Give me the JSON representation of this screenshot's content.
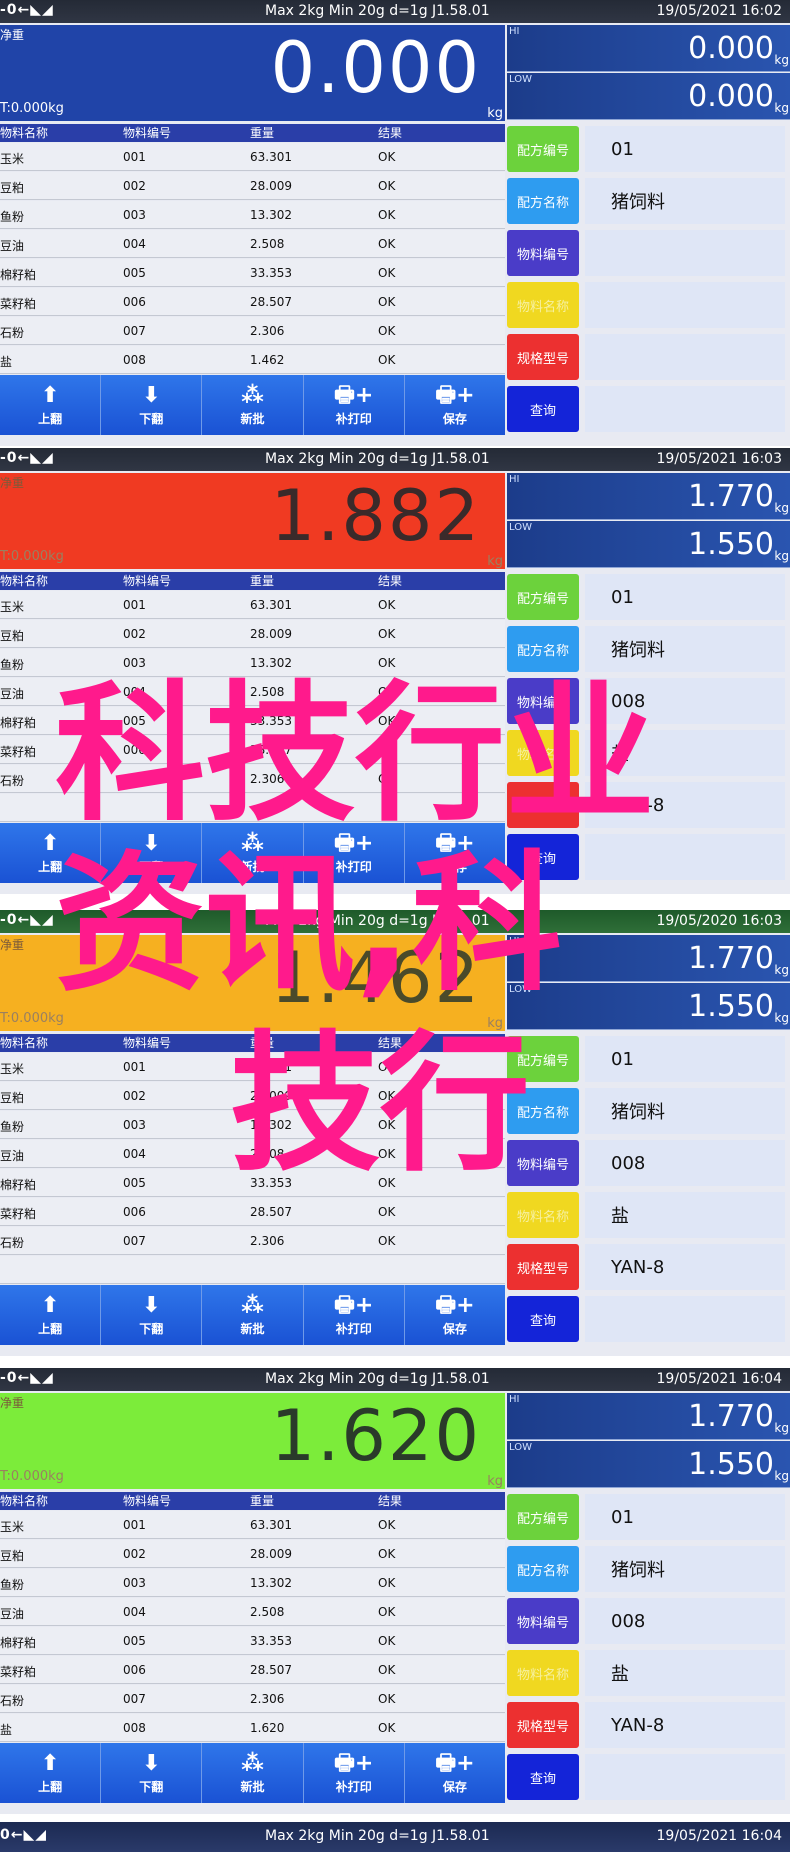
{
  "spec_text": "Max 2kg  Min 20g  d=1g    J1.58.01",
  "status_icons": "-0←◣◢",
  "net_label": "净重",
  "tare_text": "T:0.000kg",
  "unit": "kg",
  "hi_label": "HI",
  "low_label": "LOW",
  "table_headers": [
    "物料名称",
    "物料编号",
    "重量",
    "结果"
  ],
  "toolbar": [
    {
      "icon": "⬆",
      "label": "上翻"
    },
    {
      "icon": "⬇",
      "label": "下翻"
    },
    {
      "icon": "⁂",
      "label": "新批"
    },
    {
      "icon": "🖶+",
      "label": "补打印"
    },
    {
      "icon": "🖶+",
      "label": "保存"
    }
  ],
  "side_buttons": [
    {
      "label": "配方编号",
      "color": "#6cd23c"
    },
    {
      "label": "配方名称",
      "color": "#2e9cf0"
    },
    {
      "label": "物料编号",
      "color": "#4a3cc8"
    },
    {
      "label": "物料名称",
      "color": "#f0d820"
    },
    {
      "label": "规格型号",
      "color": "#ec3030"
    },
    {
      "label": "查询",
      "color": "#1424d8"
    }
  ],
  "panels": [
    {
      "datetime": "19/05/2021  16:02",
      "weight": "0.000",
      "weight_bg": "#2044a8",
      "weight_color": "#ffffff",
      "hi": "0.000",
      "low": "0.000",
      "rows": [
        [
          "玉米",
          "001",
          "63.301",
          "OK"
        ],
        [
          "豆粕",
          "002",
          "28.009",
          "OK"
        ],
        [
          "鱼粉",
          "003",
          "13.302",
          "OK"
        ],
        [
          "豆油",
          "004",
          "2.508",
          "OK"
        ],
        [
          "棉籽粕",
          "005",
          "33.353",
          "OK"
        ],
        [
          "菜籽粕",
          "006",
          "28.507",
          "OK"
        ],
        [
          "石粉",
          "007",
          "2.306",
          "OK"
        ],
        [
          "盐",
          "008",
          "1.462",
          "OK"
        ]
      ],
      "side_values": [
        "01",
        "猪饲料",
        "",
        "",
        "",
        ""
      ]
    },
    {
      "datetime": "19/05/2021  16:03",
      "weight": "1.882",
      "weight_bg": "#f03a22",
      "weight_color": "#3a2a2a",
      "hi": "1.770",
      "low": "1.550",
      "rows": [
        [
          "玉米",
          "001",
          "63.301",
          "OK"
        ],
        [
          "豆粕",
          "002",
          "28.009",
          "OK"
        ],
        [
          "鱼粉",
          "003",
          "13.302",
          "OK"
        ],
        [
          "豆油",
          "004",
          "2.508",
          "OK"
        ],
        [
          "棉籽粕",
          "005",
          "33.353",
          "OK"
        ],
        [
          "菜籽粕",
          "006",
          "28.507",
          "OK"
        ],
        [
          "石粉",
          "007",
          "2.306",
          "OK"
        ]
      ],
      "side_values": [
        "01",
        "猪饲料",
        "008",
        "盐",
        "YAN-8",
        ""
      ]
    },
    {
      "datetime": "19/05/2020  16:03",
      "weight": "1.462",
      "weight_bg": "#f6b020",
      "weight_color": "#4a4a2a",
      "hi": "1.770",
      "low": "1.550",
      "rows": [
        [
          "玉米",
          "001",
          "63.301",
          "OK"
        ],
        [
          "豆粕",
          "002",
          "28.009",
          "OK"
        ],
        [
          "鱼粉",
          "003",
          "13.302",
          "OK"
        ],
        [
          "豆油",
          "004",
          "2.508",
          "OK"
        ],
        [
          "棉籽粕",
          "005",
          "33.353",
          "OK"
        ],
        [
          "菜籽粕",
          "006",
          "28.507",
          "OK"
        ],
        [
          "石粉",
          "007",
          "2.306",
          "OK"
        ]
      ],
      "side_values": [
        "01",
        "猪饲料",
        "008",
        "盐",
        "YAN-8",
        ""
      ]
    },
    {
      "datetime": "19/05/2021  16:04",
      "weight": "1.620",
      "weight_bg": "#7cec3a",
      "weight_color": "#2a3a2a",
      "hi": "1.770",
      "low": "1.550",
      "rows": [
        [
          "玉米",
          "001",
          "63.301",
          "OK"
        ],
        [
          "豆粕",
          "002",
          "28.009",
          "OK"
        ],
        [
          "鱼粉",
          "003",
          "13.302",
          "OK"
        ],
        [
          "豆油",
          "004",
          "2.508",
          "OK"
        ],
        [
          "棉籽粕",
          "005",
          "33.353",
          "OK"
        ],
        [
          "菜籽粕",
          "006",
          "28.507",
          "OK"
        ],
        [
          "石粉",
          "007",
          "2.306",
          "OK"
        ],
        [
          "盐",
          "008",
          "1.620",
          "OK"
        ]
      ],
      "side_values": [
        "01",
        "猪饲料",
        "008",
        "盐",
        "YAN-8",
        ""
      ]
    }
  ],
  "bottom_strip": {
    "status_icons": "0←◣◢",
    "datetime": "19/05/2021  16:04"
  },
  "watermark": [
    "科技行业",
    "资讯,科",
    "技行"
  ]
}
